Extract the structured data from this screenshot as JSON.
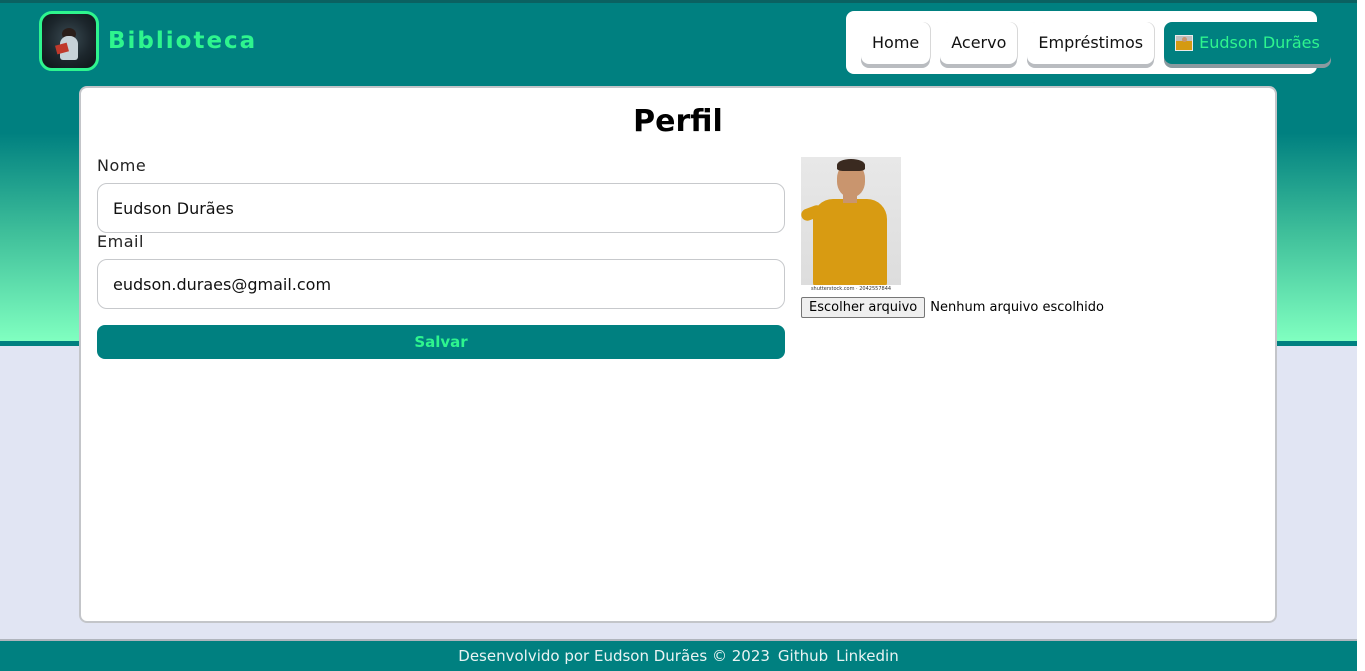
{
  "header": {
    "brand": "Biblioteca",
    "nav": {
      "home": "Home",
      "acervo": "Acervo",
      "emprestimos": "Empréstimos",
      "user": "Eudson Durães"
    }
  },
  "profile": {
    "title": "Perfil",
    "name_label": "Nome",
    "name_value": "Eudson Durães",
    "email_label": "Email",
    "email_value": "eudson.duraes@gmail.com",
    "save_label": "Salvar",
    "photo_caption": "shutterstock.com · 2042557844",
    "file_button": "Escolher arquivo",
    "file_status": "Nenhum arquivo escolhido"
  },
  "footer": {
    "text": "Desenvolvido por Eudson Durães © 2023",
    "github": "Github",
    "linkedin": "Linkedin"
  },
  "colors": {
    "primary": "#008080",
    "accent": "#2ef58e",
    "page_bg": "#e1e5f3"
  },
  "icons": {
    "logo": "reader-logo-icon",
    "user_avatar": "user-avatar-icon"
  }
}
